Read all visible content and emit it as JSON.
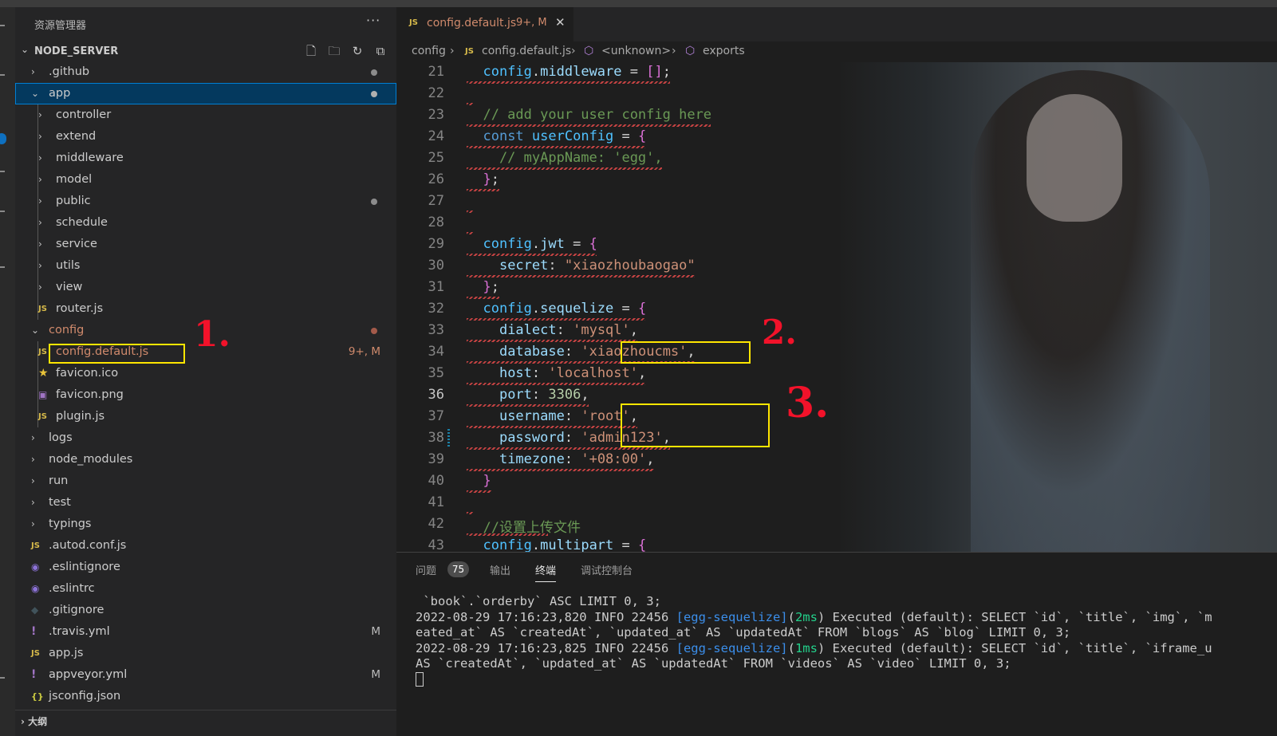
{
  "sidebar": {
    "title": "资源管理器",
    "more": "···",
    "section_name": "NODE_SERVER",
    "bottom_section": "大纲",
    "items": [
      {
        "label": ".github",
        "chev": "›",
        "dot": true
      },
      {
        "label": "app",
        "chev": "⌄",
        "dot": true
      },
      {
        "label": "controller",
        "chev": "›"
      },
      {
        "label": "extend",
        "chev": "›"
      },
      {
        "label": "middleware",
        "chev": "›"
      },
      {
        "label": "model",
        "chev": "›"
      },
      {
        "label": "public",
        "chev": "›",
        "dot": true
      },
      {
        "label": "schedule",
        "chev": "›"
      },
      {
        "label": "service",
        "chev": "›"
      },
      {
        "label": "utils",
        "chev": "›"
      },
      {
        "label": "view",
        "chev": "›"
      },
      {
        "label": "router.js",
        "icon": "JS"
      },
      {
        "label": "config",
        "chev": "⌄",
        "dot": true
      },
      {
        "label": "config.default.js",
        "icon": "JS",
        "deco": "9+, M"
      },
      {
        "label": "favicon.ico",
        "icon": "★"
      },
      {
        "label": "favicon.png",
        "icon": "▣"
      },
      {
        "label": "plugin.js",
        "icon": "JS"
      },
      {
        "label": "logs",
        "chev": "›"
      },
      {
        "label": "node_modules",
        "chev": "›"
      },
      {
        "label": "run",
        "chev": "›"
      },
      {
        "label": "test",
        "chev": "›"
      },
      {
        "label": "typings",
        "chev": "›"
      },
      {
        "label": ".autod.conf.js",
        "icon": "JS"
      },
      {
        "label": ".eslintignore",
        "icon": "◉"
      },
      {
        "label": ".eslintrc",
        "icon": "◉"
      },
      {
        "label": ".gitignore",
        "icon": "◆"
      },
      {
        "label": ".travis.yml",
        "icon": "!",
        "deco": "M"
      },
      {
        "label": "app.js",
        "icon": "JS"
      },
      {
        "label": "appveyor.yml",
        "icon": "!",
        "deco": "M"
      },
      {
        "label": "jsconfig.json",
        "icon": "{}"
      }
    ]
  },
  "editor": {
    "tab": {
      "icon": "JS",
      "name": "config.default.js",
      "deco": "9+, M",
      "close": "✕"
    },
    "breadcrumb": [
      "config",
      "config.default.js",
      "<unknown>",
      "exports"
    ],
    "current_line": 36,
    "lines": [
      {
        "n": 21,
        "code": "  config.middleware = [];"
      },
      {
        "n": 22,
        "code": ""
      },
      {
        "n": 23,
        "code": "  // add your user config here"
      },
      {
        "n": 24,
        "code": "  const userConfig = {"
      },
      {
        "n": 25,
        "code": "    // myAppName: 'egg',"
      },
      {
        "n": 26,
        "code": "  };"
      },
      {
        "n": 27,
        "code": ""
      },
      {
        "n": 28,
        "code": ""
      },
      {
        "n": 29,
        "code": "  config.jwt = {"
      },
      {
        "n": 30,
        "code": "    secret: \"xiaozhoubaogao\""
      },
      {
        "n": 31,
        "code": "  };"
      },
      {
        "n": 32,
        "code": "  config.sequelize = {"
      },
      {
        "n": 33,
        "code": "    dialect: 'mysql',"
      },
      {
        "n": 34,
        "code": "    database: 'xiaozhoucms',"
      },
      {
        "n": 35,
        "code": "    host: 'localhost',"
      },
      {
        "n": 36,
        "code": "    port: 3306,"
      },
      {
        "n": 37,
        "code": "    username: 'root',"
      },
      {
        "n": 38,
        "code": "    password: 'admin123',"
      },
      {
        "n": 39,
        "code": "    timezone: '+08:00',"
      },
      {
        "n": 40,
        "code": "  }"
      },
      {
        "n": 41,
        "code": ""
      },
      {
        "n": 42,
        "code": "  //设置上传文件"
      },
      {
        "n": 43,
        "code": "  config.multipart = {"
      }
    ]
  },
  "annotations": [
    "1.",
    "2.",
    "3."
  ],
  "panel": {
    "tabs": [
      "问题",
      "输出",
      "终端",
      "调试控制台"
    ],
    "problems_count": "75",
    "active_tab": "终端",
    "terminal": [
      " `book`.`orderby` ASC LIMIT 0, 3;",
      "2022-08-29 17:16:23,820 INFO 22456 [egg-sequelize](2ms) Executed (default): SELECT `id`, `title`, `img`, `m",
      "eated_at` AS `createdAt`, `updated_at` AS `updatedAt` FROM `blogs` AS `blog` LIMIT 0, 3;",
      "2022-08-29 17:16:23,825 INFO 22456 [egg-sequelize](1ms) Executed (default): SELECT `id`, `title`, `iframe_u",
      "AS `createdAt`, `updated_at` AS `updatedAt` FROM `videos` AS `video` LIMIT 0, 3;"
    ]
  },
  "colors": {
    "accent": "#007fd4",
    "modified": "#d08a6c",
    "annotation_box": "#ffe600",
    "annotation_text": "#f2122a"
  }
}
